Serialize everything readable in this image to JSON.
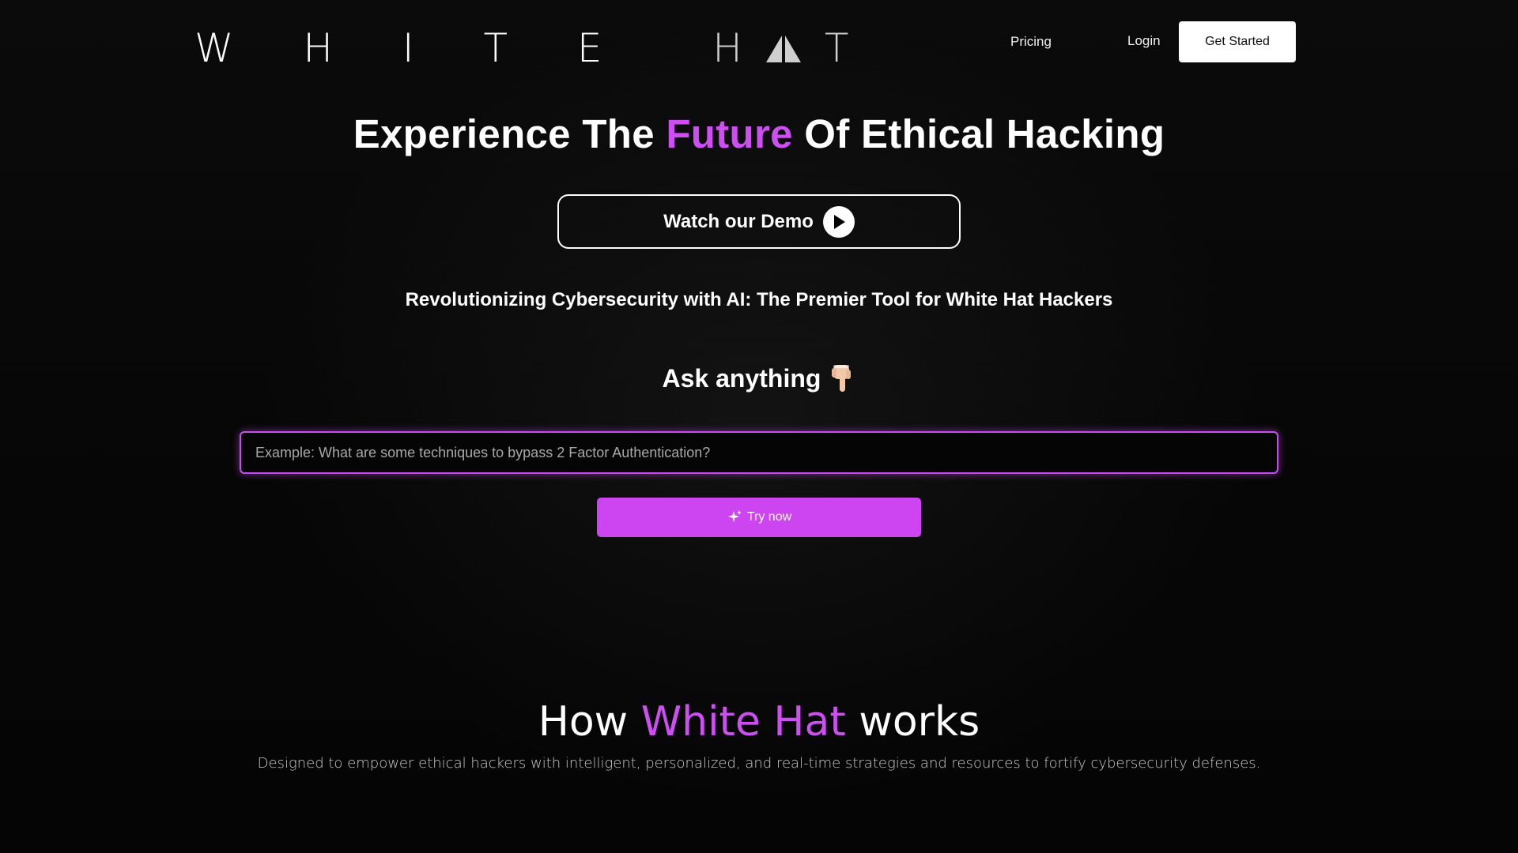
{
  "header": {
    "logo_letters": "WHITE H",
    "logo_t": "T",
    "nav_pricing": "Pricing",
    "nav_login": "Login",
    "get_started": "Get Started"
  },
  "hero": {
    "title_before": "Experience The ",
    "title_accent": "Future",
    "title_after": " Of Ethical Hacking",
    "demo_label": "Watch our Demo",
    "subtitle": "Revolutionizing Cybersecurity with AI: The Premier Tool for White Hat Hackers",
    "ask_label": "Ask anything",
    "search": {
      "placeholder": "Example: What are some techniques to bypass 2 Factor Authentication?",
      "value": ""
    },
    "try_label": "Try now"
  },
  "how": {
    "title_before": "How ",
    "title_accent": "White Hat",
    "title_after": " works",
    "description": "Designed to empower ethical hackers with intelligent, personalized, and real-time strategies and resources to fortify cybersecurity defenses."
  },
  "icons": {
    "logo_mark": "hat-triangle-icon",
    "play": "play-icon",
    "ask_hand": "pointing-down-hand-icon",
    "sparkle": "sparkle-icon"
  },
  "colors": {
    "accent": "#cd4ff2",
    "background": "#070707",
    "button_accent": "#cd45f0"
  }
}
